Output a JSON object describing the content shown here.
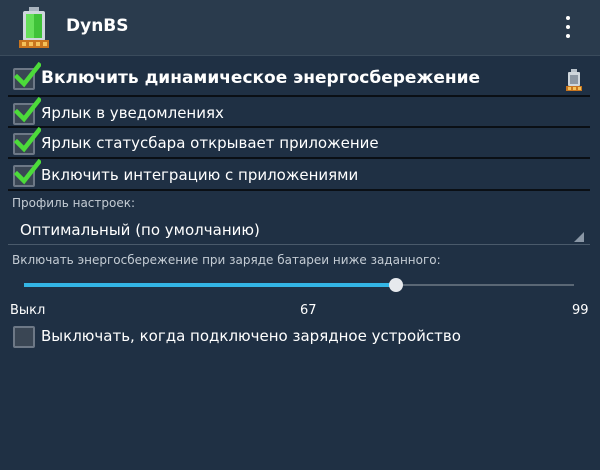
{
  "app": {
    "title": "DynBS",
    "icon": "battery-icon",
    "menu_icon": "overflow-menu-icon"
  },
  "settings": {
    "dynamic_saving": {
      "label": "Включить динамическое энергосбережение",
      "checked": true,
      "icon": "battery-status-icon"
    },
    "notification_shortcut": {
      "label": "Ярлык в уведомлениях",
      "checked": true
    },
    "statusbar_opens_app": {
      "label": "Ярлык статусбара открывает приложение",
      "checked": true
    },
    "app_integration": {
      "label": "Включить интеграцию с приложениями",
      "checked": true
    }
  },
  "profile": {
    "label": "Профиль настроек:",
    "value": "Оптимальный (по умолчанию)"
  },
  "threshold": {
    "label": "Включать энергосбережение при заряде батареи ниже заданного:",
    "min_label": "Выкл",
    "value": "67",
    "max_label": "99",
    "level": 67,
    "max": 99
  },
  "charger_off": {
    "label": "Выключать, когда подключено зарядное устройство",
    "checked": false
  },
  "colors": {
    "background": "#1f3044",
    "actionbar": "#2a3b4d",
    "check_green": "#4cdb3a",
    "seek_accent": "#33b5e5"
  }
}
